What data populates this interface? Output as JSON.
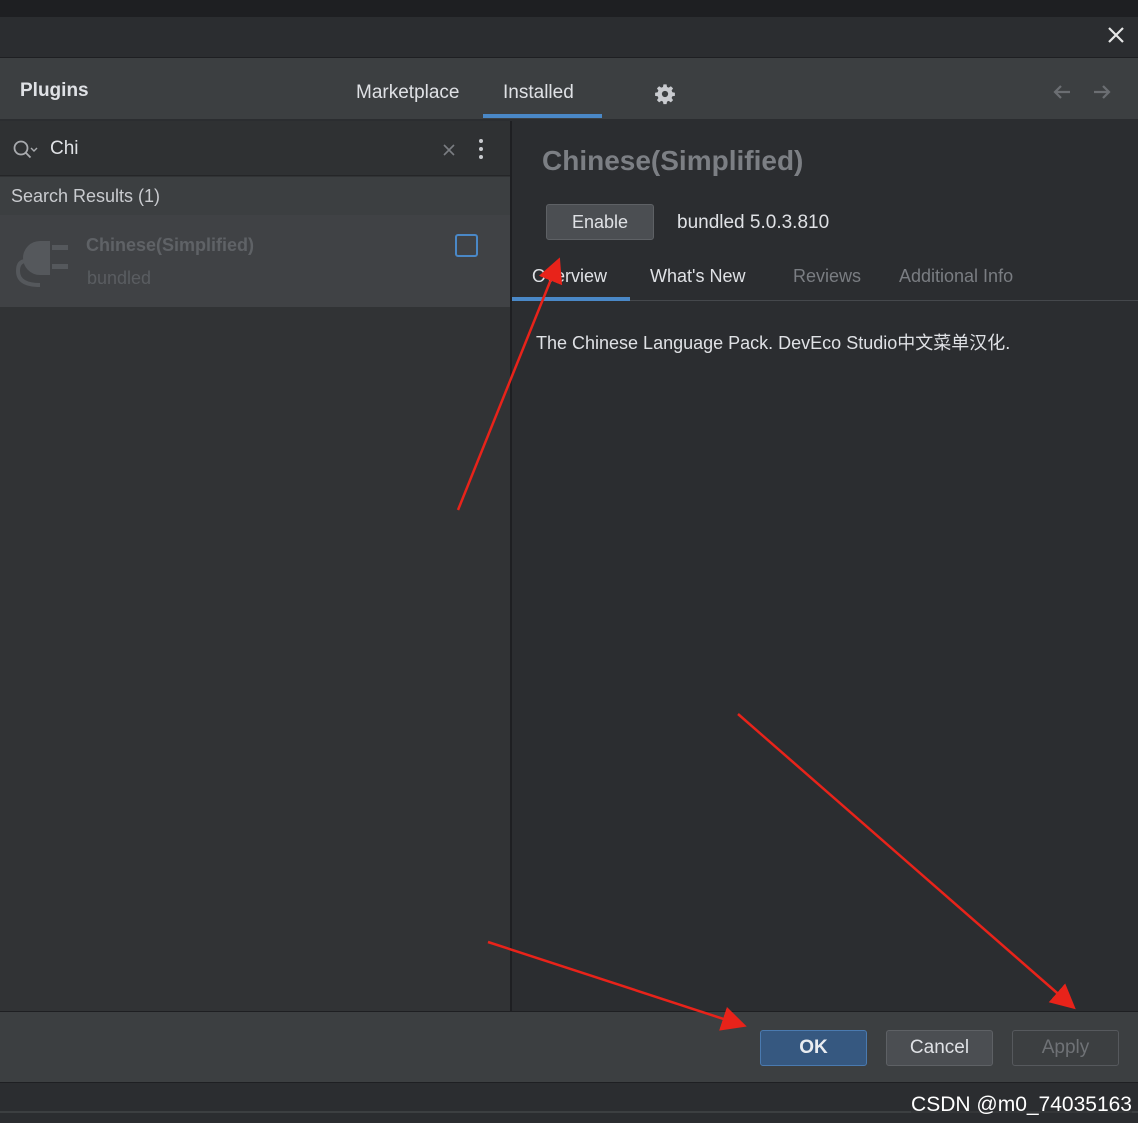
{
  "dialog": {
    "title": "Plugins",
    "tabs": [
      {
        "label": "Marketplace",
        "active": false
      },
      {
        "label": "Installed",
        "active": true
      }
    ],
    "icons": {
      "close": "close-icon",
      "settings": "gear-icon",
      "back": "arrow-left-icon",
      "forward": "arrow-right-icon"
    }
  },
  "search": {
    "value": "Chi",
    "icon": "search-icon",
    "clear_icon": "clear-icon",
    "menu_icon": "more-vertical-icon"
  },
  "results": {
    "header": "Search Results (1)",
    "items": [
      {
        "name": "Chinese(Simplified)",
        "subtitle": "bundled",
        "icon": "plug-icon",
        "checked": false
      }
    ]
  },
  "detail": {
    "title": "Chinese(Simplified)",
    "enable_label": "Enable",
    "version": "bundled 5.0.3.810",
    "tabs": [
      {
        "label": "Overview",
        "active": true
      },
      {
        "label": "What's New",
        "active": false
      },
      {
        "label": "Reviews",
        "active": false
      },
      {
        "label": "Additional Info",
        "active": false
      }
    ],
    "description": "The Chinese Language Pack. DevEco Studio中文菜单汉化."
  },
  "footer": {
    "ok_label": "OK",
    "cancel_label": "Cancel",
    "apply_label": "Apply"
  },
  "watermark": "CSDN @m0_74035163",
  "colors": {
    "accent": "#4a88c7",
    "annotation_arrow": "#e8231a",
    "background": "#2b2d30"
  }
}
